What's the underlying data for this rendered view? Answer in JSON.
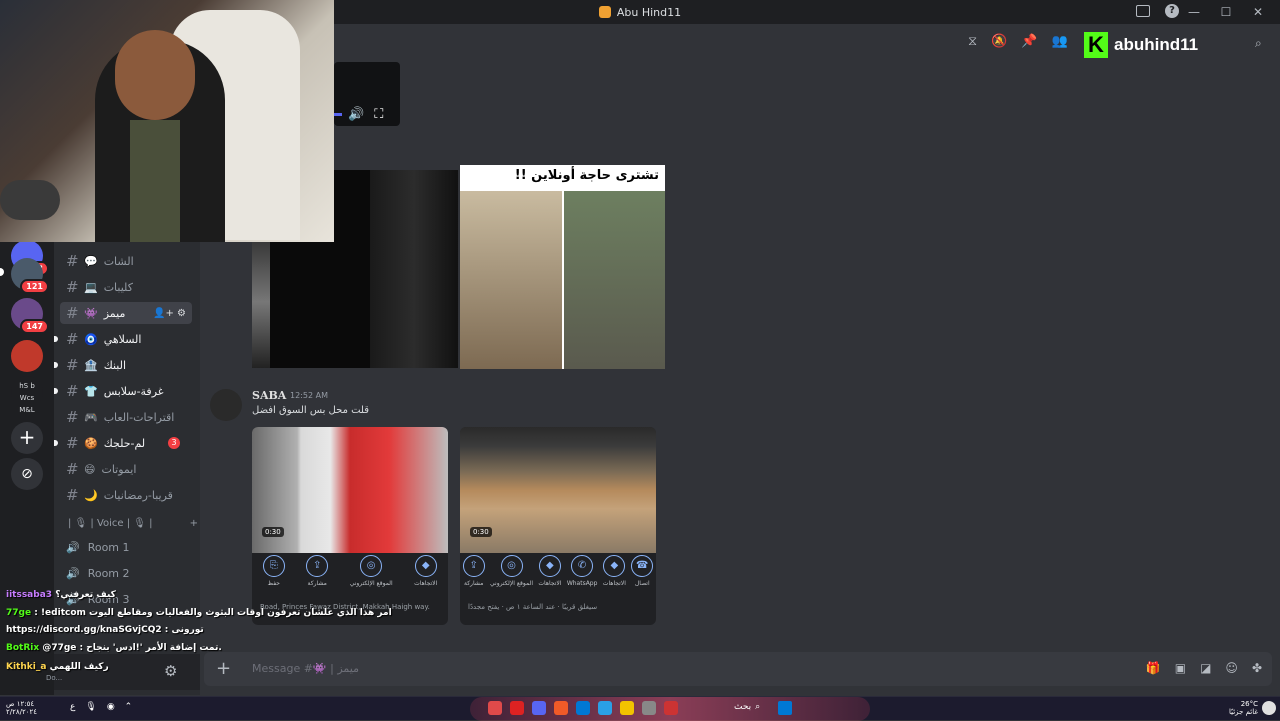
{
  "window": {
    "title": "Abu Hind11",
    "minimize": "—",
    "maximize": "☐",
    "close": "✕",
    "help": "?"
  },
  "header": {
    "streamer": "abuhind11",
    "kick_logo": "K",
    "search_label": "Search Abu Hind11",
    "icons": [
      "threads-icon",
      "mute-icon",
      "pin-icon",
      "members-icon"
    ]
  },
  "rail": {
    "badges": [
      "712",
      "121",
      "147"
    ],
    "servers": [
      "hS b",
      "Wcs M&L"
    ],
    "add": "+",
    "explore": "⊘"
  },
  "channels": [
    {
      "emoji": "💬",
      "name": "الشات",
      "state": ""
    },
    {
      "emoji": "💻",
      "name": "كليبات",
      "state": ""
    },
    {
      "emoji": "👾",
      "name": "ميمز",
      "state": "active"
    },
    {
      "emoji": "🧿",
      "name": "السلاهي",
      "state": "unread"
    },
    {
      "emoji": "🏦",
      "name": "البنك",
      "state": "unread"
    },
    {
      "emoji": "👕",
      "name": "غرفة-سلابس",
      "state": "unread"
    },
    {
      "emoji": "🎮",
      "name": "اقتراحات-العاب",
      "state": ""
    },
    {
      "emoji": "🍪",
      "name": "لم-حلجك",
      "state": "unread",
      "badge": "3"
    },
    {
      "emoji": "😄",
      "name": "ايموتات",
      "state": ""
    },
    {
      "emoji": "🌙",
      "name": "قريبا-رمضانيات",
      "state": ""
    }
  ],
  "voice": {
    "category": "| 🎙 | Voice | 🎙 |",
    "rooms": [
      "Room 1",
      "Room 2",
      "Room 3"
    ]
  },
  "message": {
    "author": "SABA",
    "time": "12:52 AM",
    "text": "قلت محل بس السوق افضل"
  },
  "image2_caption": "!! تشترى حاجة أونلاين",
  "card1": {
    "duration": "0:30",
    "actions": [
      "حفظ",
      "مشاركة",
      "الموقع الإلكتروني",
      "الاتجاهات"
    ],
    "footer": "Road, Princes Fawaz District, Makkah Haigh way."
  },
  "card2": {
    "duration": "0:30",
    "actions": [
      "مشاركة",
      "الموقع الإلكتروني",
      "الاتجاهات",
      "WhatsApp",
      "الاتجاهات",
      "اتصال"
    ],
    "footer": "سيغلق قريبًا · عند الساعة ١ ص · يفتح مجددًا"
  },
  "chat": [
    {
      "user": "iitssaba3",
      "text": "كيف تعرفني؟"
    },
    {
      "user": "77ge",
      "text": "!editcom امر هذا الذي علشان تعرفون اوقات البثوث والفعاليات ومقاطع اليوت"
    },
    {
      "user": "",
      "text": "https://discord.gg/knaSGvjCQ2 : تورونى"
    },
    {
      "user": "BotRix",
      "text": "@77ge : تمت إضافة الأمر '!ادس' بنجاح."
    },
    {
      "user": "Kithki_a",
      "text": "ركيف اللهمي"
    }
  ],
  "user_status": "Do...",
  "composer": {
    "placeholder": "Message #👾 | ميمز",
    "plus": "+"
  },
  "taskbar": {
    "search": "بحث",
    "time": "١٢:٥٤ ص",
    "date": "٢/٢٨/٢٠٢٤",
    "weather": "26°C",
    "weather_desc": "غائم جزئيًا",
    "lang": "ع"
  }
}
